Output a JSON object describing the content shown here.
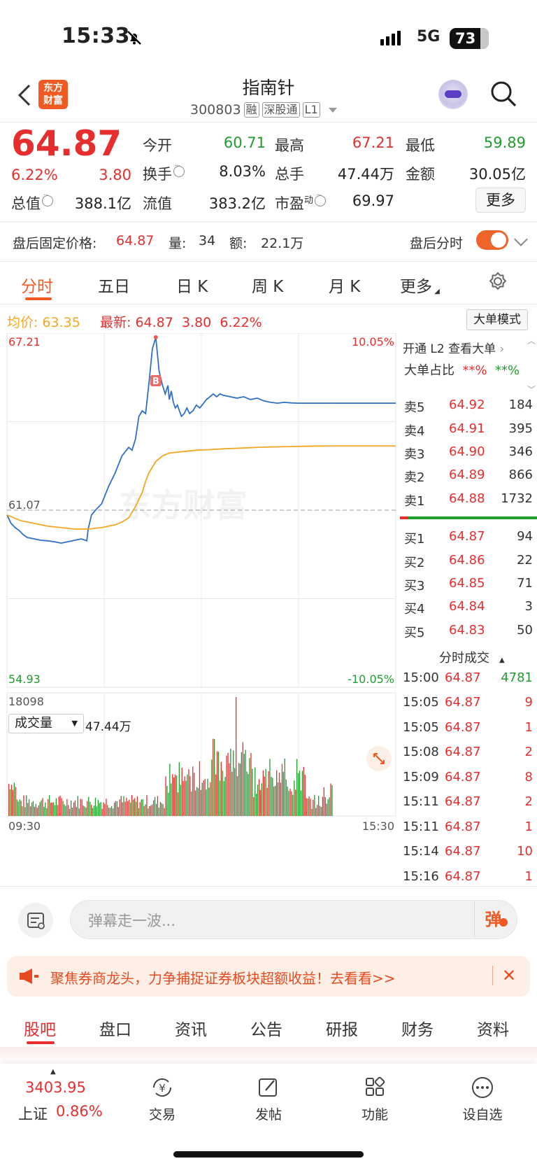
{
  "status_bar": {
    "time": "15:33",
    "network": "5G",
    "battery": "73"
  },
  "nav": {
    "logo_line1": "东方",
    "logo_line2": "财富",
    "title": "指南针",
    "code": "300803",
    "tags": [
      "融",
      "深股通",
      "L1"
    ]
  },
  "quote": {
    "price": "64.87",
    "change_pct": "6.22%",
    "change": "3.80",
    "stats": [
      {
        "label": "今开",
        "value": "60.71",
        "color": "green"
      },
      {
        "label": "最高",
        "value": "67.21",
        "color": "red"
      },
      {
        "label": "最低",
        "value": "59.89",
        "color": "green"
      },
      {
        "label": "换手",
        "value": "8.03%",
        "color": "dark"
      },
      {
        "label": "总手",
        "value": "47.44万",
        "color": "dark"
      },
      {
        "label": "金额",
        "value": "30.05亿",
        "color": "dark"
      },
      {
        "label": "总值",
        "value": "388.1亿",
        "color": "dark"
      },
      {
        "label": "流值",
        "value": "383.2亿",
        "color": "dark"
      },
      {
        "label": "市盈",
        "label_sup": "动",
        "value": "69.97",
        "color": "dark"
      }
    ],
    "more_label": "更多"
  },
  "after_hours": {
    "label": "盘后固定价格:",
    "price": "64.87",
    "vol_label": "量:",
    "vol": "34",
    "amt_label": "额:",
    "amt": "22.1万",
    "timeshare_label": "盘后分时",
    "timeshare_on": true
  },
  "tabs": [
    {
      "label": "分时",
      "active": true
    },
    {
      "label": "五日"
    },
    {
      "label": "日 K"
    },
    {
      "label": "周 K"
    },
    {
      "label": "月 K"
    },
    {
      "label": "更多"
    }
  ],
  "info_line": {
    "avg_label": "均价:",
    "avg": "63.35",
    "latest_label": "最新:",
    "latest": "64.87",
    "chg": "3.80",
    "pct": "6.22%",
    "big_order_btn": "大单模式"
  },
  "chart_data": {
    "type": "line",
    "title": "",
    "y_top": "67.21",
    "y_mid": "61.07",
    "y_bottom": "54.93",
    "pct_top": "10.05%",
    "pct_bottom": "-10.05%",
    "ylim": [
      54.93,
      67.21
    ],
    "prev_close": 61.07,
    "buy_marker": "B",
    "x_start": "09:30",
    "x_end": "15:30",
    "series": [
      {
        "kind": "price",
        "color": "#2f6fc8",
        "x": [
          0,
          6,
          12,
          18,
          24,
          30,
          40,
          50,
          60,
          70,
          80,
          90,
          100,
          110,
          118,
          120,
          125,
          132,
          140,
          150,
          160,
          170,
          180,
          185,
          190,
          195,
          200,
          205,
          210,
          215,
          220,
          225,
          230,
          234,
          238,
          240,
          243,
          246,
          249,
          252,
          255,
          258,
          262,
          266,
          270,
          275,
          280,
          285,
          290,
          295,
          300,
          305,
          310,
          315,
          320,
          330,
          340,
          350,
          360,
          370,
          380,
          390,
          400,
          410,
          420,
          430,
          440,
          450,
          460,
          470,
          480
        ],
        "y": [
          60.9,
          60.6,
          60.45,
          60.35,
          60.2,
          60.1,
          60.05,
          60.0,
          59.98,
          59.95,
          59.9,
          59.95,
          60.0,
          60.05,
          59.98,
          60.4,
          60.9,
          61.1,
          61.3,
          61.9,
          62.4,
          63.0,
          63.3,
          63.2,
          63.6,
          64.4,
          64.6,
          64.5,
          65.6,
          66.8,
          67.21,
          66.0,
          65.5,
          65.2,
          65.5,
          65.0,
          65.3,
          64.9,
          64.7,
          64.8,
          64.6,
          64.4,
          64.5,
          64.7,
          64.5,
          64.6,
          64.8,
          64.7,
          64.85,
          65.0,
          65.1,
          65.2,
          65.1,
          65.2,
          65.15,
          65.1,
          65.05,
          65.1,
          65.0,
          65.05,
          64.95,
          64.9,
          64.87,
          64.9,
          64.88,
          64.87,
          64.87,
          64.87,
          64.87,
          64.87,
          64.87
        ]
      },
      {
        "kind": "avg",
        "color": "#f5a623",
        "x": [
          0,
          20,
          40,
          60,
          80,
          100,
          120,
          140,
          160,
          170,
          180,
          190,
          200,
          205,
          210,
          215,
          220,
          230,
          240,
          260,
          280,
          300,
          320,
          340,
          360,
          380,
          400,
          420,
          440,
          460,
          480
        ],
        "y": [
          60.9,
          60.7,
          60.6,
          60.5,
          60.45,
          60.4,
          60.4,
          60.45,
          60.55,
          60.65,
          60.8,
          61.2,
          61.7,
          62.1,
          62.4,
          62.6,
          62.8,
          63.0,
          63.1,
          63.15,
          63.2,
          63.22,
          63.25,
          63.27,
          63.29,
          63.31,
          63.32,
          63.33,
          63.34,
          63.35,
          63.35
        ]
      }
    ],
    "volume": {
      "label": "成交量",
      "total": "47.44万",
      "ymax_label": "18098",
      "ymax": 18098
    }
  },
  "order_book": {
    "promo": "开通 L2 查看大单",
    "ratio_label": "大单占比",
    "ratio_buy": "**%",
    "ratio_sell": "**%",
    "asks": [
      {
        "side": "卖5",
        "price": "64.92",
        "qty": "184"
      },
      {
        "side": "卖4",
        "price": "64.91",
        "qty": "395"
      },
      {
        "side": "卖3",
        "price": "64.90",
        "qty": "346"
      },
      {
        "side": "卖2",
        "price": "64.89",
        "qty": "866"
      },
      {
        "side": "卖1",
        "price": "64.88",
        "qty": "1732"
      }
    ],
    "bids": [
      {
        "side": "买1",
        "price": "64.87",
        "qty": "94"
      },
      {
        "side": "买2",
        "price": "64.86",
        "qty": "22"
      },
      {
        "side": "买3",
        "price": "64.85",
        "qty": "71"
      },
      {
        "side": "买4",
        "price": "64.84",
        "qty": "3"
      },
      {
        "side": "买5",
        "price": "64.83",
        "qty": "50"
      }
    ],
    "trades_label": "分时成交",
    "trades": [
      {
        "time": "15:00",
        "price": "64.87",
        "vol": "4781",
        "color": "green"
      },
      {
        "time": "15:05",
        "price": "64.87",
        "vol": "9",
        "color": "red"
      },
      {
        "time": "15:05",
        "price": "64.87",
        "vol": "1",
        "color": "red"
      },
      {
        "time": "15:08",
        "price": "64.87",
        "vol": "2",
        "color": "red"
      },
      {
        "time": "15:09",
        "price": "64.87",
        "vol": "8",
        "color": "red"
      },
      {
        "time": "15:11",
        "price": "64.87",
        "vol": "2",
        "color": "red"
      },
      {
        "time": "15:11",
        "price": "64.87",
        "vol": "1",
        "color": "red"
      },
      {
        "time": "15:14",
        "price": "64.87",
        "vol": "10",
        "color": "red"
      },
      {
        "time": "15:16",
        "price": "64.87",
        "vol": "1",
        "color": "red"
      }
    ]
  },
  "danmu": {
    "placeholder": "弹幕走一波...",
    "send": "弹"
  },
  "banner": {
    "text": "聚焦券商龙头，力争捕捉证券板块超额收益！去看看>>"
  },
  "bottom_tabs": [
    {
      "label": "股吧",
      "active": true
    },
    {
      "label": "盘口"
    },
    {
      "label": "资讯"
    },
    {
      "label": "公告"
    },
    {
      "label": "研报"
    },
    {
      "label": "财务"
    },
    {
      "label": "资料"
    }
  ],
  "footer": {
    "index_value": "3403.95",
    "index_name": "上证",
    "index_pct": "0.86%",
    "items": [
      {
        "label": "交易",
        "icon": "yuan-cycle-icon"
      },
      {
        "label": "发帖",
        "icon": "edit-icon"
      },
      {
        "label": "功能",
        "icon": "grid-icon"
      },
      {
        "label": "设自选",
        "icon": "more-dots-icon"
      }
    ]
  }
}
